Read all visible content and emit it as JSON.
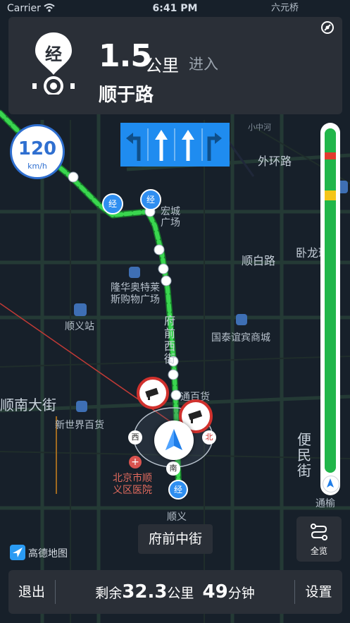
{
  "status_bar": {
    "carrier": "Carrier",
    "time": "6:41 PM"
  },
  "nav": {
    "maneuver_badge": "经",
    "distance": "1.5",
    "distance_unit": "公里",
    "action": "进入",
    "next_road": "顺于路"
  },
  "speed_limit": {
    "value": "120",
    "unit": "km/h"
  },
  "map_labels": {
    "wuhuan": "外环路",
    "xiaozhong": "小中河",
    "shunbai": "顺白路",
    "wolong": "卧龙环岛",
    "hongcheng": "宏城\n广场",
    "longhua": "隆华奥特莱\n斯购物广场",
    "shunyi_station": "顺义站",
    "fuqian_xi": "府前西街",
    "guotai": "国泰谊宾商城",
    "shunnan": "顺南大街",
    "xinshijie": "新世界百货",
    "tongbai": "通百货",
    "bianmin": "便民街",
    "hospital": "北京市顺\n义区医院",
    "shunyi": "顺义",
    "tongyu": "通榆",
    "liuyuan": "六元桥",
    "waypoint": "经",
    "west_tag": "西",
    "north_tag": "北",
    "south_tag": "南"
  },
  "current_road": "府前中街",
  "overview_button": {
    "label": "全览"
  },
  "logo": {
    "text": "高德地图"
  },
  "bottom_bar": {
    "exit_label": "退出",
    "remaining_prefix": "剩余",
    "remaining_distance": "32.3",
    "distance_unit": "公里",
    "remaining_time": "49",
    "time_unit": "分钟",
    "settings_label": "设置"
  },
  "traffic_progress": {
    "segments": [
      {
        "from": 0.0,
        "to": 0.07,
        "status": "smooth"
      },
      {
        "from": 0.07,
        "to": 0.09,
        "status": "congested"
      },
      {
        "from": 0.09,
        "to": 0.18,
        "status": "smooth"
      },
      {
        "from": 0.18,
        "to": 0.21,
        "status": "slow"
      },
      {
        "from": 0.21,
        "to": 1.0,
        "status": "smooth"
      }
    ],
    "colors": {
      "smooth": "#21b64a",
      "slow": "#f5c518",
      "congested": "#e23b2f"
    }
  },
  "colors": {
    "accent": "#1f8cf0",
    "route": "#3ad64f"
  }
}
